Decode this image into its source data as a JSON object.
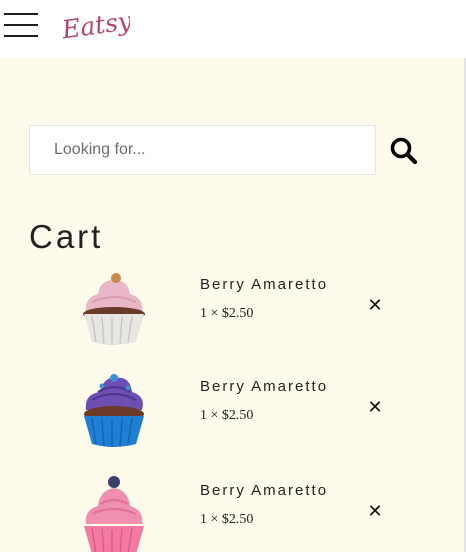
{
  "header": {
    "logo_text": "Eatsy",
    "menu_icon": "hamburger-menu-icon",
    "brand_color": "#b6456b"
  },
  "search": {
    "placeholder": "Looking for...",
    "value": "",
    "icon": "search-icon"
  },
  "cart": {
    "title": "Cart",
    "items": [
      {
        "name": "Berry Amaretto",
        "qty_price": "1 × $2.50",
        "image": "pink-frosted-cupcake-with-nut",
        "remove_icon": "close-icon"
      },
      {
        "name": "Berry Amaretto",
        "qty_price": "1 × $2.50",
        "image": "purple-frosted-cupcake-blue-liner",
        "remove_icon": "close-icon"
      },
      {
        "name": "Berry Amaretto",
        "qty_price": "1 × $2.50",
        "image": "pink-frosted-cupcake-with-blueberry",
        "remove_icon": "close-icon"
      }
    ]
  },
  "colors": {
    "page_background": "#fffbec",
    "header_background": "#ffffff",
    "text": "#222222"
  }
}
